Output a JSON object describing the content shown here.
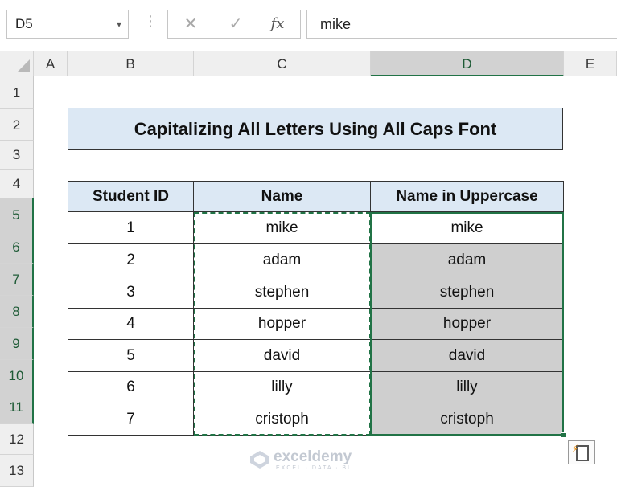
{
  "formula_bar": {
    "name_box": "D5",
    "name_box_arrow": "▾",
    "separator": "⋮",
    "cancel_glyph": "✕",
    "enter_glyph": "✓",
    "fx_glyph": "fx",
    "formula": "mike"
  },
  "columns": [
    "A",
    "B",
    "C",
    "D",
    "E"
  ],
  "selected_column": "D",
  "rows": [
    "1",
    "2",
    "3",
    "4",
    "5",
    "6",
    "7",
    "8",
    "9",
    "10",
    "11",
    "12",
    "13"
  ],
  "selected_rows": [
    "5",
    "6",
    "7",
    "8",
    "9",
    "10",
    "11"
  ],
  "title": "Capitalizing All Letters Using All Caps Font",
  "table": {
    "headers": [
      "Student ID",
      "Name",
      "Name in Uppercase"
    ],
    "rows": [
      [
        "1",
        "mike",
        "mike"
      ],
      [
        "2",
        "adam",
        "adam"
      ],
      [
        "3",
        "stephen",
        "stephen"
      ],
      [
        "4",
        "hopper",
        "hopper"
      ],
      [
        "5",
        "david",
        "david"
      ],
      [
        "6",
        "lilly",
        "lilly"
      ],
      [
        "7",
        "cristoph",
        "cristoph"
      ]
    ]
  },
  "watermark": {
    "name": "exceldemy",
    "tagline": "EXCEL · DATA · BI"
  },
  "colors": {
    "accent_green": "#217346",
    "header_fill": "#dce8f4",
    "selection_fill": "#cfcfcf"
  },
  "icons": {
    "cancel": "close-icon",
    "enter": "check-icon",
    "function": "fx-icon",
    "paste_options": "paste-options-icon",
    "name_box_dropdown": "chevron-down-icon"
  }
}
